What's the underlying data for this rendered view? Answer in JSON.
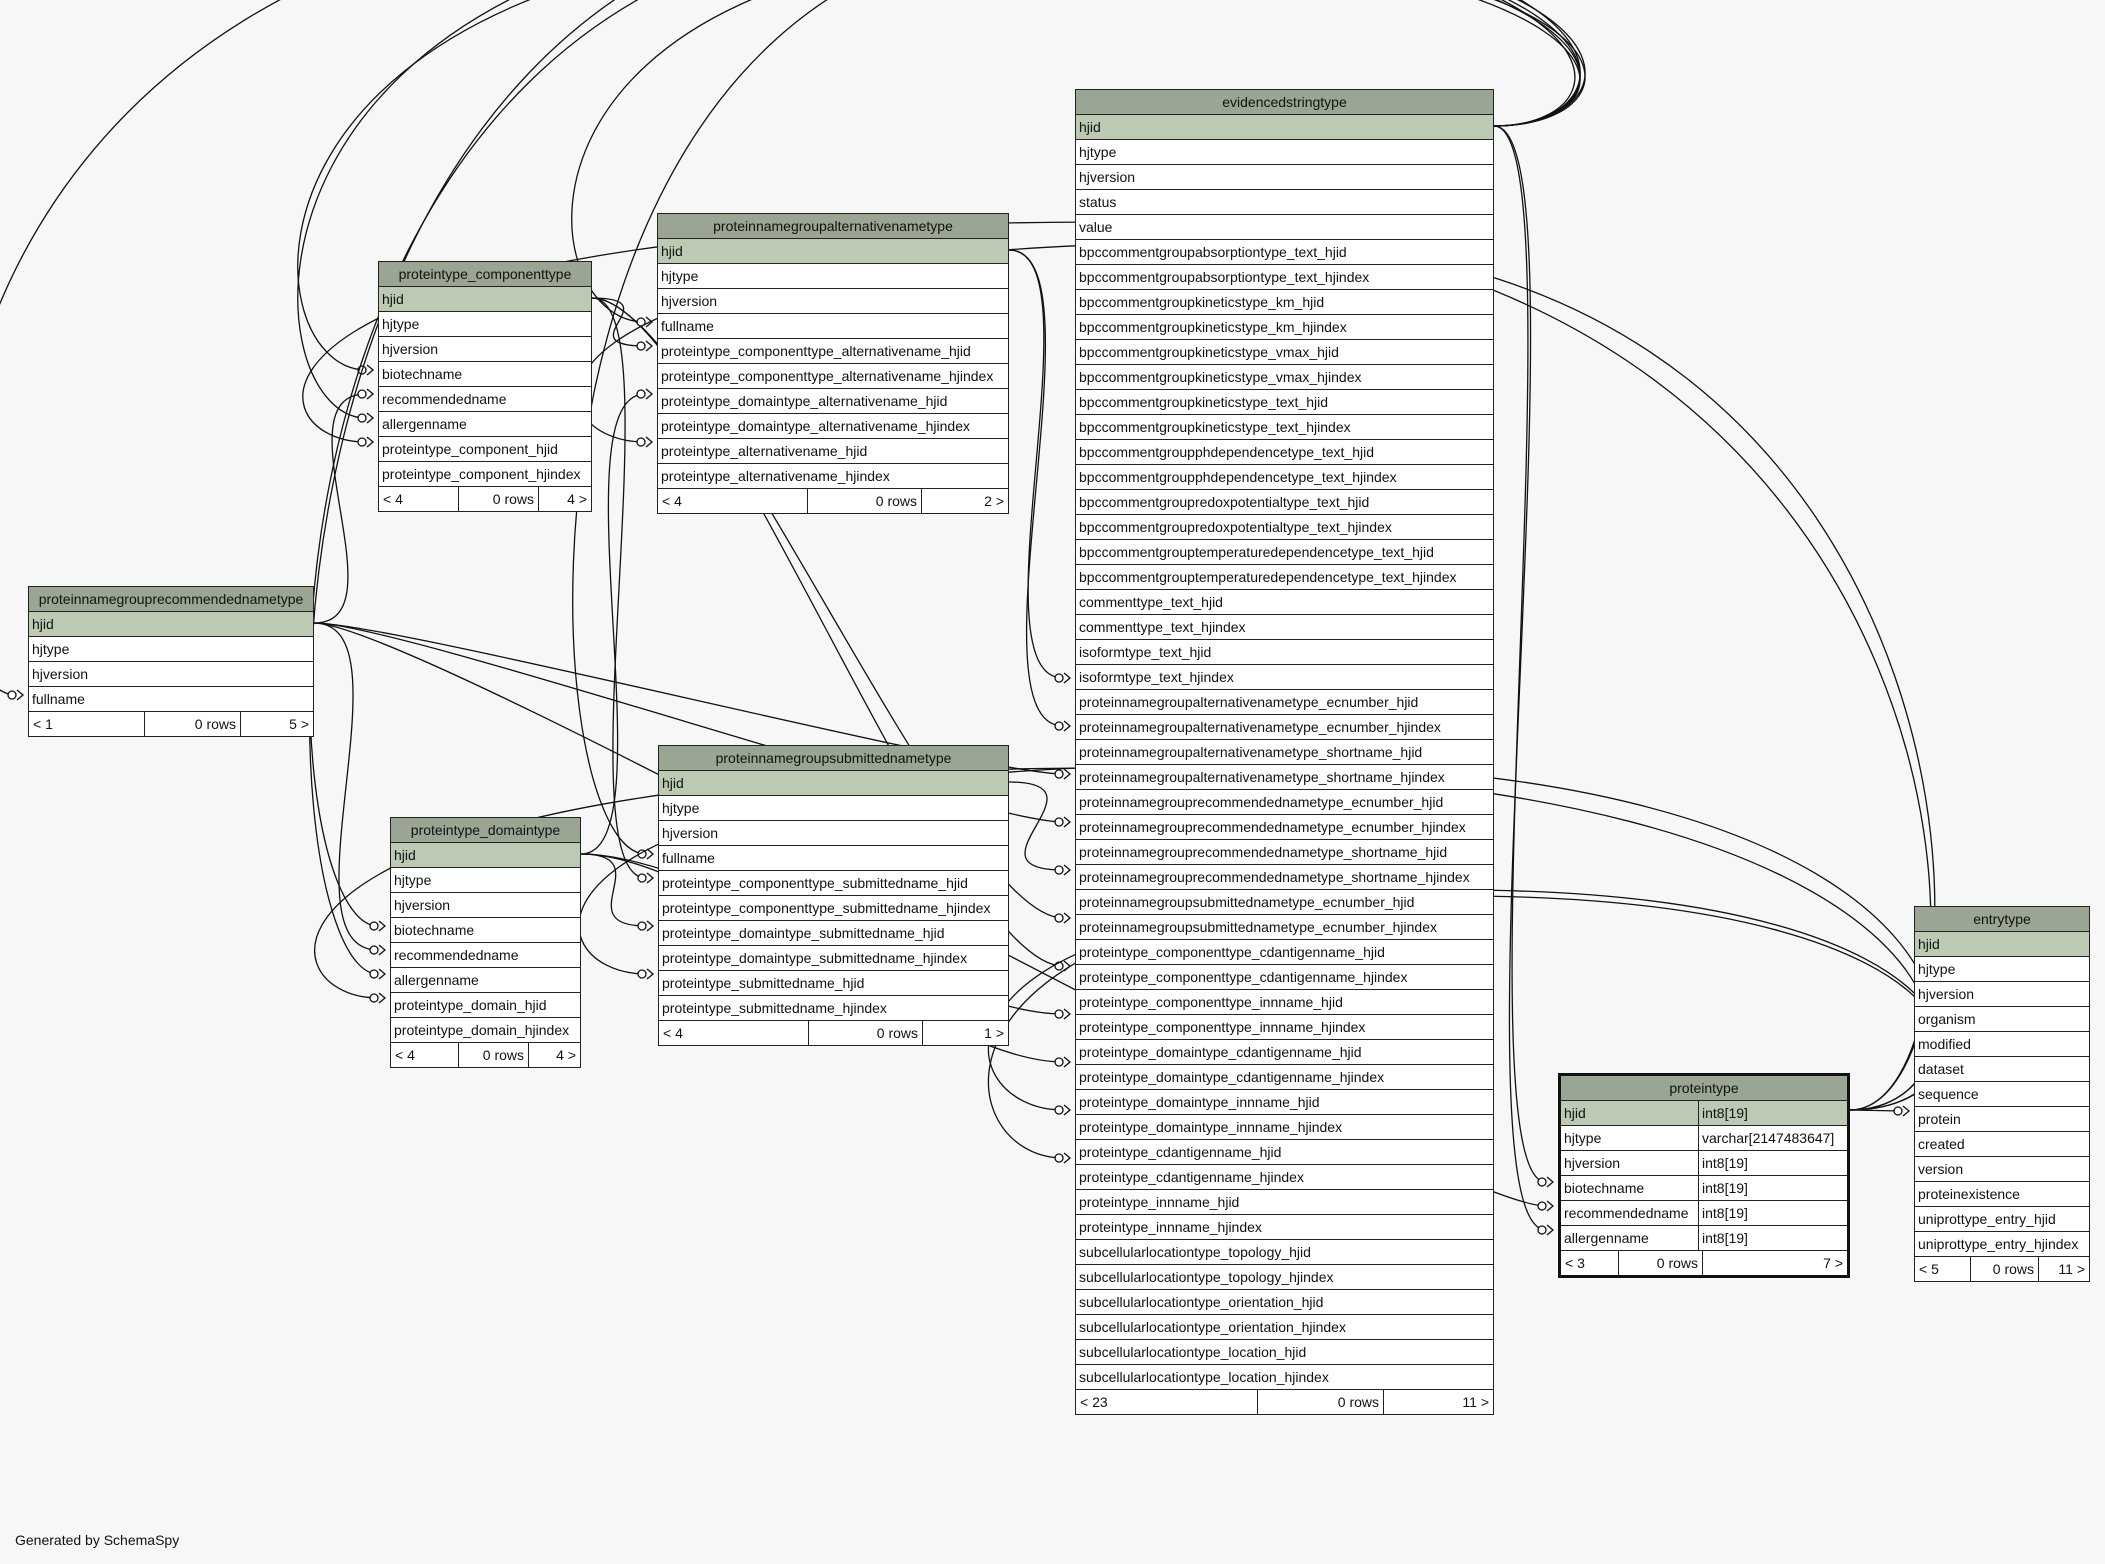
{
  "generator": "Generated by SchemaSpy",
  "tables": {
    "rec": {
      "name": "proteinnamegrouprecommendednametype",
      "pk": "hjid",
      "columns": [
        "hjtype",
        "hjversion",
        "fullname"
      ],
      "footer": [
        "< 1",
        "0 rows",
        "5 >"
      ]
    },
    "comp": {
      "name": "proteintype_componenttype",
      "pk": "hjid",
      "columns": [
        "hjtype",
        "hjversion",
        "biotechname",
        "recommendedname",
        "allergenname",
        "proteintype_component_hjid",
        "proteintype_component_hjindex"
      ],
      "footer": [
        "< 4",
        "0 rows",
        "4 >"
      ]
    },
    "alt": {
      "name": "proteinnamegroupalternativenametype",
      "pk": "hjid",
      "columns": [
        "hjtype",
        "hjversion",
        "fullname",
        "proteintype_componenttype_alternativename_hjid",
        "proteintype_componenttype_alternativename_hjindex",
        "proteintype_domaintype_alternativename_hjid",
        "proteintype_domaintype_alternativename_hjindex",
        "proteintype_alternativename_hjid",
        "proteintype_alternativename_hjindex"
      ],
      "footer": [
        "< 4",
        "0 rows",
        "2 >"
      ]
    },
    "dom": {
      "name": "proteintype_domaintype",
      "pk": "hjid",
      "columns": [
        "hjtype",
        "hjversion",
        "biotechname",
        "recommendedname",
        "allergenname",
        "proteintype_domain_hjid",
        "proteintype_domain_hjindex"
      ],
      "footer": [
        "< 4",
        "0 rows",
        "4 >"
      ]
    },
    "sub": {
      "name": "proteinnamegroupsubmittednametype",
      "pk": "hjid",
      "columns": [
        "hjtype",
        "hjversion",
        "fullname",
        "proteintype_componenttype_submittedname_hjid",
        "proteintype_componenttype_submittedname_hjindex",
        "proteintype_domaintype_submittedname_hjid",
        "proteintype_domaintype_submittedname_hjindex",
        "proteintype_submittedname_hjid",
        "proteintype_submittedname_hjindex"
      ],
      "footer": [
        "< 4",
        "0 rows",
        "1 >"
      ]
    },
    "evid": {
      "name": "evidencedstringtype",
      "pk": "hjid",
      "columns": [
        "hjtype",
        "hjversion",
        "status",
        "value",
        "bpccommentgroupabsorptiontype_text_hjid",
        "bpccommentgroupabsorptiontype_text_hjindex",
        "bpccommentgroupkineticstype_km_hjid",
        "bpccommentgroupkineticstype_km_hjindex",
        "bpccommentgroupkineticstype_vmax_hjid",
        "bpccommentgroupkineticstype_vmax_hjindex",
        "bpccommentgroupkineticstype_text_hjid",
        "bpccommentgroupkineticstype_text_hjindex",
        "bpccommentgroupphdependencetype_text_hjid",
        "bpccommentgroupphdependencetype_text_hjindex",
        "bpccommentgroupredoxpotentialtype_text_hjid",
        "bpccommentgroupredoxpotentialtype_text_hjindex",
        "bpccommentgrouptemperaturedependencetype_text_hjid",
        "bpccommentgrouptemperaturedependencetype_text_hjindex",
        "commenttype_text_hjid",
        "commenttype_text_hjindex",
        "isoformtype_text_hjid",
        "isoformtype_text_hjindex",
        "proteinnamegroupalternativenametype_ecnumber_hjid",
        "proteinnamegroupalternativenametype_ecnumber_hjindex",
        "proteinnamegroupalternativenametype_shortname_hjid",
        "proteinnamegroupalternativenametype_shortname_hjindex",
        "proteinnamegrouprecommendednametype_ecnumber_hjid",
        "proteinnamegrouprecommendednametype_ecnumber_hjindex",
        "proteinnamegrouprecommendednametype_shortname_hjid",
        "proteinnamegrouprecommendednametype_shortname_hjindex",
        "proteinnamegroupsubmittednametype_ecnumber_hjid",
        "proteinnamegroupsubmittednametype_ecnumber_hjindex",
        "proteintype_componenttype_cdantigenname_hjid",
        "proteintype_componenttype_cdantigenname_hjindex",
        "proteintype_componenttype_innname_hjid",
        "proteintype_componenttype_innname_hjindex",
        "proteintype_domaintype_cdantigenname_hjid",
        "proteintype_domaintype_cdantigenname_hjindex",
        "proteintype_domaintype_innname_hjid",
        "proteintype_domaintype_innname_hjindex",
        "proteintype_cdantigenname_hjid",
        "proteintype_cdantigenname_hjindex",
        "proteintype_innname_hjid",
        "proteintype_innname_hjindex",
        "subcellularlocationtype_topology_hjid",
        "subcellularlocationtype_topology_hjindex",
        "subcellularlocationtype_orientation_hjid",
        "subcellularlocationtype_orientation_hjindex",
        "subcellularlocationtype_location_hjid",
        "subcellularlocationtype_location_hjindex"
      ],
      "footer": [
        "< 23",
        "0 rows",
        "11 >"
      ]
    },
    "prot": {
      "name": "proteintype",
      "pk": "hjid",
      "pk_type": "int8[19]",
      "columns": [
        {
          "name": "hjtype",
          "type": "varchar[2147483647]"
        },
        {
          "name": "hjversion",
          "type": "int8[19]"
        },
        {
          "name": "biotechname",
          "type": "int8[19]"
        },
        {
          "name": "recommendedname",
          "type": "int8[19]"
        },
        {
          "name": "allergenname",
          "type": "int8[19]"
        }
      ],
      "footer": [
        "< 3",
        "0 rows",
        "7 >"
      ]
    },
    "entry": {
      "name": "entrytype",
      "pk": "hjid",
      "columns": [
        "hjtype",
        "hjversion",
        "organism",
        "modified",
        "dataset",
        "sequence",
        "protein",
        "created",
        "version",
        "proteinexistence",
        "uniprottype_entry_hjid",
        "uniprottype_entry_hjindex"
      ],
      "footer": [
        "< 5",
        "0 rows",
        "11 >"
      ]
    }
  },
  "colors": {
    "header": "#9aa693",
    "primary_key_row": "#bccab4",
    "line": "#111111",
    "background": "#f7f7f7"
  }
}
